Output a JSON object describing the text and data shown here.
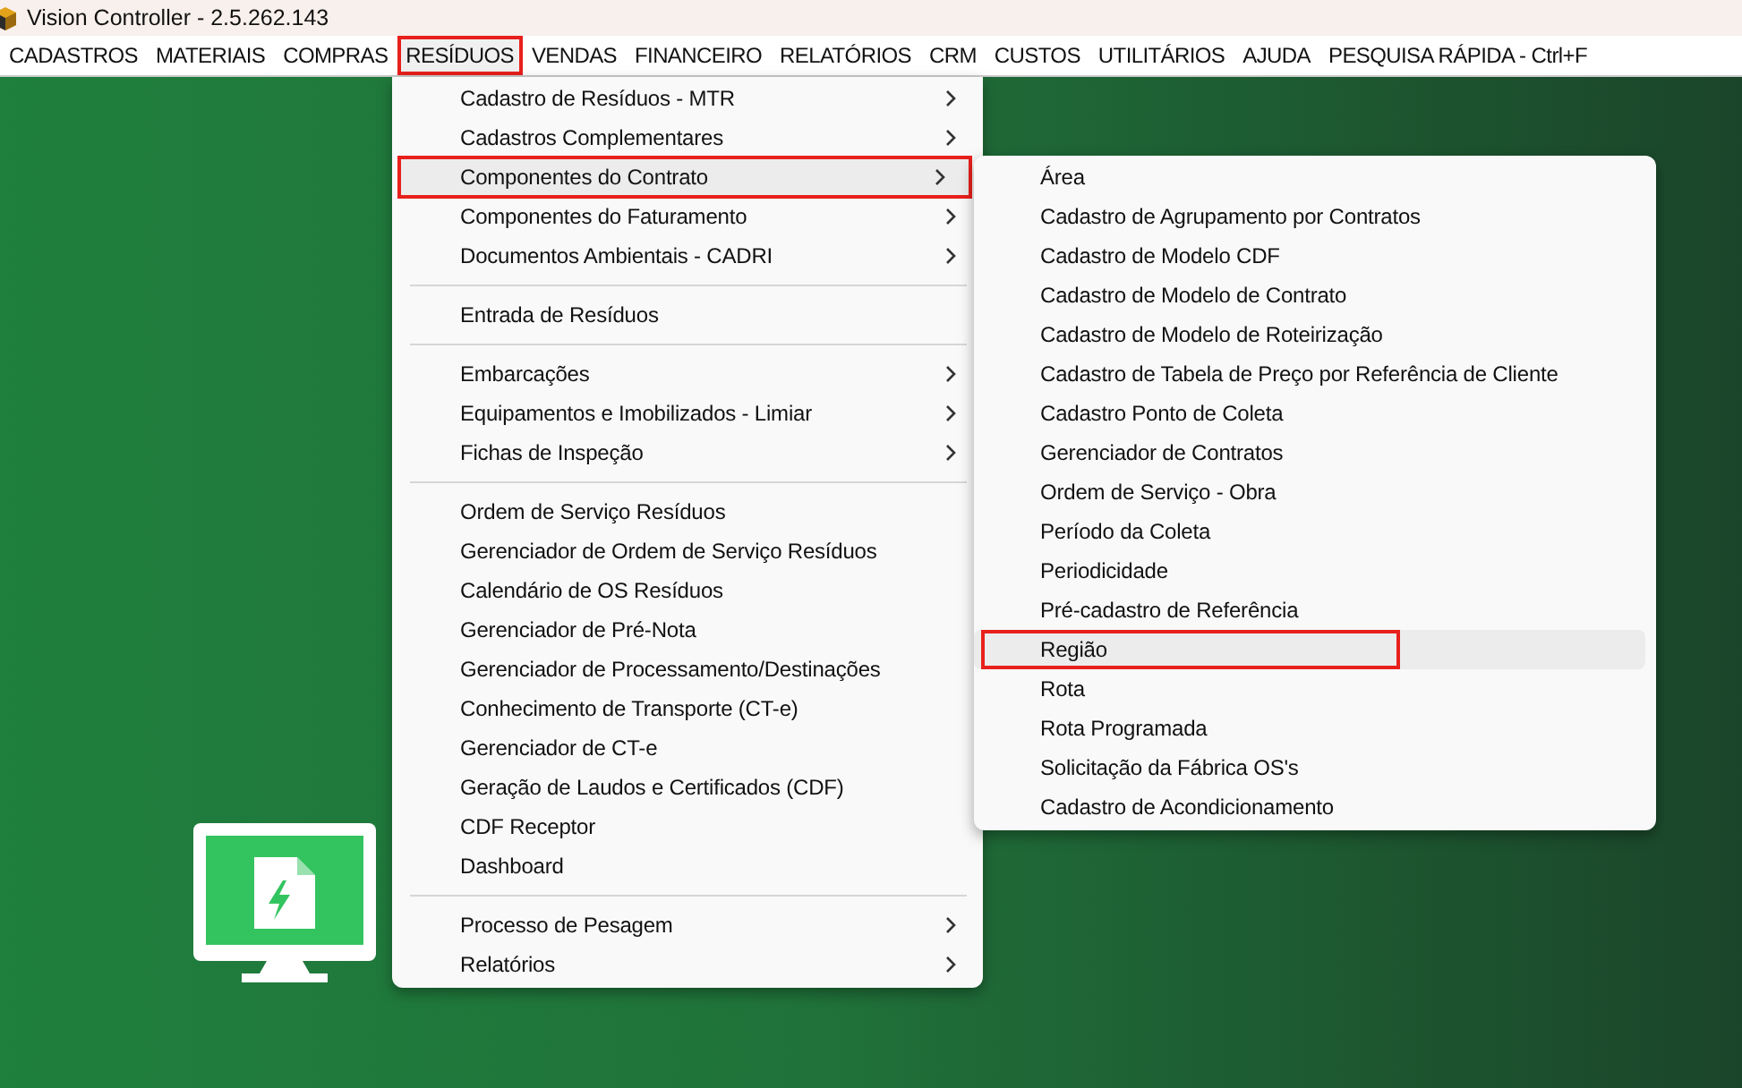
{
  "window": {
    "title": "Vision Controller - 2.5.262.143"
  },
  "menubar": [
    {
      "label": "CADASTROS",
      "selected": false,
      "marked": false
    },
    {
      "label": "MATERIAIS",
      "selected": false,
      "marked": false
    },
    {
      "label": "COMPRAS",
      "selected": false,
      "marked": false
    },
    {
      "label": "RESÍDUOS",
      "selected": true,
      "marked": true
    },
    {
      "label": "VENDAS",
      "selected": false,
      "marked": false
    },
    {
      "label": "FINANCEIRO",
      "selected": false,
      "marked": false
    },
    {
      "label": "RELATÓRIOS",
      "selected": false,
      "marked": false
    },
    {
      "label": "CRM",
      "selected": false,
      "marked": false
    },
    {
      "label": "CUSTOS",
      "selected": false,
      "marked": false
    },
    {
      "label": "UTILITÁRIOS",
      "selected": false,
      "marked": false
    },
    {
      "label": "AJUDA",
      "selected": false,
      "marked": false
    },
    {
      "label": "PESQUISA RÁPIDA  -  Ctrl+F",
      "selected": false,
      "marked": false
    }
  ],
  "menu": {
    "groups": [
      [
        {
          "label": "Cadastro de Resíduos - MTR",
          "submenu": true,
          "selected": false,
          "marked": false
        },
        {
          "label": "Cadastros Complementares",
          "submenu": true,
          "selected": false,
          "marked": false
        },
        {
          "label": "Componentes do Contrato",
          "submenu": true,
          "selected": true,
          "marked": true
        },
        {
          "label": "Componentes do Faturamento",
          "submenu": true,
          "selected": false,
          "marked": false
        },
        {
          "label": "Documentos Ambientais - CADRI",
          "submenu": true,
          "selected": false,
          "marked": false
        }
      ],
      [
        {
          "label": "Entrada de Resíduos",
          "submenu": false,
          "selected": false,
          "marked": false
        }
      ],
      [
        {
          "label": "Embarcações",
          "submenu": true,
          "selected": false,
          "marked": false
        },
        {
          "label": "Equipamentos e Imobilizados - Limiar",
          "submenu": true,
          "selected": false,
          "marked": false
        },
        {
          "label": "Fichas de Inspeção",
          "submenu": true,
          "selected": false,
          "marked": false
        }
      ],
      [
        {
          "label": "Ordem de Serviço Resíduos",
          "submenu": false,
          "selected": false,
          "marked": false
        },
        {
          "label": "Gerenciador de Ordem de Serviço Resíduos",
          "submenu": false,
          "selected": false,
          "marked": false
        },
        {
          "label": "Calendário de OS Resíduos",
          "submenu": false,
          "selected": false,
          "marked": false
        },
        {
          "label": "Gerenciador de Pré-Nota",
          "submenu": false,
          "selected": false,
          "marked": false
        },
        {
          "label": "Gerenciador de Processamento/Destinações",
          "submenu": false,
          "selected": false,
          "marked": false
        },
        {
          "label": "Conhecimento de Transporte (CT-e)",
          "submenu": false,
          "selected": false,
          "marked": false
        },
        {
          "label": "Gerenciador de CT-e",
          "submenu": false,
          "selected": false,
          "marked": false
        },
        {
          "label": "Geração de Laudos e Certificados (CDF)",
          "submenu": false,
          "selected": false,
          "marked": false
        },
        {
          "label": "CDF Receptor",
          "submenu": false,
          "selected": false,
          "marked": false
        },
        {
          "label": "Dashboard",
          "submenu": false,
          "selected": false,
          "marked": false
        }
      ],
      [
        {
          "label": "Processo de Pesagem",
          "submenu": true,
          "selected": false,
          "marked": false
        },
        {
          "label": "Relatórios",
          "submenu": true,
          "selected": false,
          "marked": false
        }
      ]
    ]
  },
  "submenu": {
    "groups": [
      [
        {
          "label": "Área",
          "submenu": false,
          "selected": false,
          "marked": false
        },
        {
          "label": "Cadastro de Agrupamento por Contratos",
          "submenu": false,
          "selected": false,
          "marked": false
        },
        {
          "label": "Cadastro de Modelo CDF",
          "submenu": false,
          "selected": false,
          "marked": false
        },
        {
          "label": "Cadastro de Modelo de Contrato",
          "submenu": false,
          "selected": false,
          "marked": false
        },
        {
          "label": "Cadastro de Modelo de Roteirização",
          "submenu": false,
          "selected": false,
          "marked": false
        },
        {
          "label": "Cadastro de Tabela de Preço por Referência de Cliente",
          "submenu": false,
          "selected": false,
          "marked": false
        },
        {
          "label": "Cadastro Ponto de Coleta",
          "submenu": false,
          "selected": false,
          "marked": false
        },
        {
          "label": "Gerenciador de Contratos",
          "submenu": false,
          "selected": false,
          "marked": false
        },
        {
          "label": "Ordem de Serviço - Obra",
          "submenu": false,
          "selected": false,
          "marked": false
        },
        {
          "label": "Período da Coleta",
          "submenu": false,
          "selected": false,
          "marked": false
        },
        {
          "label": "Periodicidade",
          "submenu": false,
          "selected": false,
          "marked": false
        },
        {
          "label": "Pré-cadastro de Referência",
          "submenu": false,
          "selected": false,
          "marked": false
        },
        {
          "label": "Região",
          "submenu": false,
          "selected": true,
          "marked": true
        },
        {
          "label": "Rota",
          "submenu": false,
          "selected": false,
          "marked": false
        },
        {
          "label": "Rota Programada",
          "submenu": false,
          "selected": false,
          "marked": false
        },
        {
          "label": "Solicitação da Fábrica OS's",
          "submenu": false,
          "selected": false,
          "marked": false
        },
        {
          "label": "Cadastro de Acondicionamento",
          "submenu": false,
          "selected": false,
          "marked": false
        }
      ]
    ]
  }
}
